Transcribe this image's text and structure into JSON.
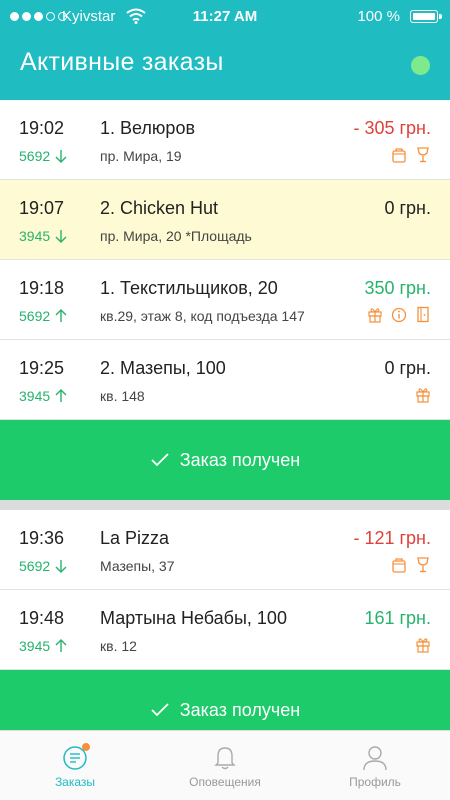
{
  "status_bar": {
    "carrier": "Kyivstar",
    "time": "11:27 AM",
    "battery": "100 %"
  },
  "header": {
    "title": "Активные заказы"
  },
  "groups": [
    {
      "orders": [
        {
          "time": "19:02",
          "code": "5692",
          "direction": "down",
          "title": "1. Велюров",
          "address": "пр. Мира, 19",
          "price": "- 305 грн.",
          "price_status": "negative",
          "icons": [
            "bag-icon",
            "glass-icon"
          ]
        },
        {
          "time": "19:07",
          "code": "3945",
          "direction": "down",
          "title": "2. Chicken Hut",
          "address": "пр. Мира, 20 *Площадь",
          "price": "0 грн.",
          "price_status": "zero",
          "icons": [],
          "highlighted": true
        },
        {
          "time": "19:18",
          "code": "5692",
          "direction": "up",
          "title": "1. Текстильщиков, 20",
          "address": "кв.29, этаж 8, код подъезда 147",
          "price": "350 грн.",
          "price_status": "positive",
          "icons": [
            "gift-icon",
            "info-icon",
            "door-icon"
          ]
        },
        {
          "time": "19:25",
          "code": "3945",
          "direction": "up",
          "title": "2. Мазепы, 100",
          "address": "кв. 148",
          "price": "0 грн.",
          "price_status": "zero",
          "icons": [
            "gift-icon"
          ]
        }
      ],
      "button_label": "Заказ получен"
    },
    {
      "orders": [
        {
          "time": "19:36",
          "code": "5692",
          "direction": "down",
          "title": "La Pizza",
          "address": "Мазепы, 37",
          "price": "- 121 грн.",
          "price_status": "negative",
          "icons": [
            "bag-icon",
            "glass-icon"
          ]
        },
        {
          "time": "19:48",
          "code": "3945",
          "direction": "up",
          "title": "Мартына Небабы, 100",
          "address": "кв. 12",
          "price": "161 грн.",
          "price_status": "positive",
          "icons": [
            "gift-icon"
          ]
        }
      ],
      "button_label": "Заказ получен"
    }
  ],
  "tabs": [
    {
      "label": "Заказы",
      "icon": "orders-list-icon",
      "active": true,
      "badge": true
    },
    {
      "label": "Оповещения",
      "icon": "bell-icon",
      "active": false
    },
    {
      "label": "Профиль",
      "icon": "profile-icon",
      "active": false
    }
  ],
  "colors": {
    "header": "#1fbcc2",
    "accent_green": "#1dcb6b",
    "negative": "#e0413b",
    "positive": "#26b36c",
    "zero": "#222222",
    "icon_orange": "#f5913e",
    "highlight_row": "#fefad3",
    "online": "#7deb8b"
  }
}
